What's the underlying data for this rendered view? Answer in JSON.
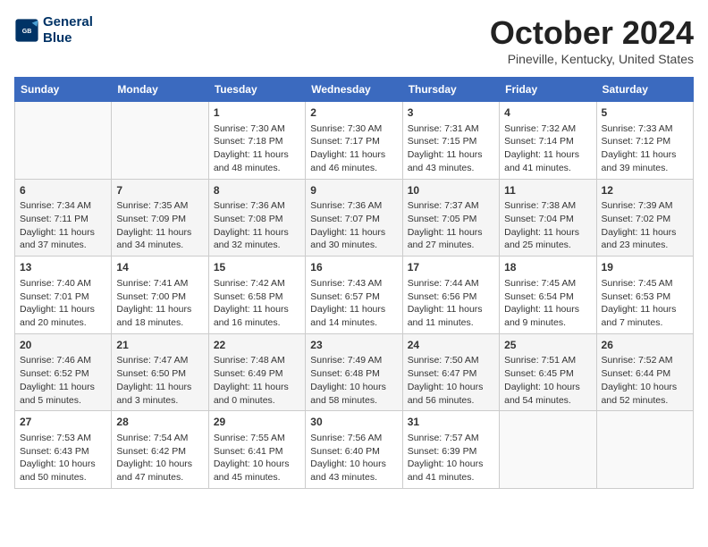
{
  "header": {
    "logo_line1": "General",
    "logo_line2": "Blue",
    "month": "October 2024",
    "location": "Pineville, Kentucky, United States"
  },
  "days_of_week": [
    "Sunday",
    "Monday",
    "Tuesday",
    "Wednesday",
    "Thursday",
    "Friday",
    "Saturday"
  ],
  "weeks": [
    [
      {
        "day": "",
        "sunrise": "",
        "sunset": "",
        "daylight": ""
      },
      {
        "day": "",
        "sunrise": "",
        "sunset": "",
        "daylight": ""
      },
      {
        "day": "1",
        "sunrise": "Sunrise: 7:30 AM",
        "sunset": "Sunset: 7:18 PM",
        "daylight": "Daylight: 11 hours and 48 minutes."
      },
      {
        "day": "2",
        "sunrise": "Sunrise: 7:30 AM",
        "sunset": "Sunset: 7:17 PM",
        "daylight": "Daylight: 11 hours and 46 minutes."
      },
      {
        "day": "3",
        "sunrise": "Sunrise: 7:31 AM",
        "sunset": "Sunset: 7:15 PM",
        "daylight": "Daylight: 11 hours and 43 minutes."
      },
      {
        "day": "4",
        "sunrise": "Sunrise: 7:32 AM",
        "sunset": "Sunset: 7:14 PM",
        "daylight": "Daylight: 11 hours and 41 minutes."
      },
      {
        "day": "5",
        "sunrise": "Sunrise: 7:33 AM",
        "sunset": "Sunset: 7:12 PM",
        "daylight": "Daylight: 11 hours and 39 minutes."
      }
    ],
    [
      {
        "day": "6",
        "sunrise": "Sunrise: 7:34 AM",
        "sunset": "Sunset: 7:11 PM",
        "daylight": "Daylight: 11 hours and 37 minutes."
      },
      {
        "day": "7",
        "sunrise": "Sunrise: 7:35 AM",
        "sunset": "Sunset: 7:09 PM",
        "daylight": "Daylight: 11 hours and 34 minutes."
      },
      {
        "day": "8",
        "sunrise": "Sunrise: 7:36 AM",
        "sunset": "Sunset: 7:08 PM",
        "daylight": "Daylight: 11 hours and 32 minutes."
      },
      {
        "day": "9",
        "sunrise": "Sunrise: 7:36 AM",
        "sunset": "Sunset: 7:07 PM",
        "daylight": "Daylight: 11 hours and 30 minutes."
      },
      {
        "day": "10",
        "sunrise": "Sunrise: 7:37 AM",
        "sunset": "Sunset: 7:05 PM",
        "daylight": "Daylight: 11 hours and 27 minutes."
      },
      {
        "day": "11",
        "sunrise": "Sunrise: 7:38 AM",
        "sunset": "Sunset: 7:04 PM",
        "daylight": "Daylight: 11 hours and 25 minutes."
      },
      {
        "day": "12",
        "sunrise": "Sunrise: 7:39 AM",
        "sunset": "Sunset: 7:02 PM",
        "daylight": "Daylight: 11 hours and 23 minutes."
      }
    ],
    [
      {
        "day": "13",
        "sunrise": "Sunrise: 7:40 AM",
        "sunset": "Sunset: 7:01 PM",
        "daylight": "Daylight: 11 hours and 20 minutes."
      },
      {
        "day": "14",
        "sunrise": "Sunrise: 7:41 AM",
        "sunset": "Sunset: 7:00 PM",
        "daylight": "Daylight: 11 hours and 18 minutes."
      },
      {
        "day": "15",
        "sunrise": "Sunrise: 7:42 AM",
        "sunset": "Sunset: 6:58 PM",
        "daylight": "Daylight: 11 hours and 16 minutes."
      },
      {
        "day": "16",
        "sunrise": "Sunrise: 7:43 AM",
        "sunset": "Sunset: 6:57 PM",
        "daylight": "Daylight: 11 hours and 14 minutes."
      },
      {
        "day": "17",
        "sunrise": "Sunrise: 7:44 AM",
        "sunset": "Sunset: 6:56 PM",
        "daylight": "Daylight: 11 hours and 11 minutes."
      },
      {
        "day": "18",
        "sunrise": "Sunrise: 7:45 AM",
        "sunset": "Sunset: 6:54 PM",
        "daylight": "Daylight: 11 hours and 9 minutes."
      },
      {
        "day": "19",
        "sunrise": "Sunrise: 7:45 AM",
        "sunset": "Sunset: 6:53 PM",
        "daylight": "Daylight: 11 hours and 7 minutes."
      }
    ],
    [
      {
        "day": "20",
        "sunrise": "Sunrise: 7:46 AM",
        "sunset": "Sunset: 6:52 PM",
        "daylight": "Daylight: 11 hours and 5 minutes."
      },
      {
        "day": "21",
        "sunrise": "Sunrise: 7:47 AM",
        "sunset": "Sunset: 6:50 PM",
        "daylight": "Daylight: 11 hours and 3 minutes."
      },
      {
        "day": "22",
        "sunrise": "Sunrise: 7:48 AM",
        "sunset": "Sunset: 6:49 PM",
        "daylight": "Daylight: 11 hours and 0 minutes."
      },
      {
        "day": "23",
        "sunrise": "Sunrise: 7:49 AM",
        "sunset": "Sunset: 6:48 PM",
        "daylight": "Daylight: 10 hours and 58 minutes."
      },
      {
        "day": "24",
        "sunrise": "Sunrise: 7:50 AM",
        "sunset": "Sunset: 6:47 PM",
        "daylight": "Daylight: 10 hours and 56 minutes."
      },
      {
        "day": "25",
        "sunrise": "Sunrise: 7:51 AM",
        "sunset": "Sunset: 6:45 PM",
        "daylight": "Daylight: 10 hours and 54 minutes."
      },
      {
        "day": "26",
        "sunrise": "Sunrise: 7:52 AM",
        "sunset": "Sunset: 6:44 PM",
        "daylight": "Daylight: 10 hours and 52 minutes."
      }
    ],
    [
      {
        "day": "27",
        "sunrise": "Sunrise: 7:53 AM",
        "sunset": "Sunset: 6:43 PM",
        "daylight": "Daylight: 10 hours and 50 minutes."
      },
      {
        "day": "28",
        "sunrise": "Sunrise: 7:54 AM",
        "sunset": "Sunset: 6:42 PM",
        "daylight": "Daylight: 10 hours and 47 minutes."
      },
      {
        "day": "29",
        "sunrise": "Sunrise: 7:55 AM",
        "sunset": "Sunset: 6:41 PM",
        "daylight": "Daylight: 10 hours and 45 minutes."
      },
      {
        "day": "30",
        "sunrise": "Sunrise: 7:56 AM",
        "sunset": "Sunset: 6:40 PM",
        "daylight": "Daylight: 10 hours and 43 minutes."
      },
      {
        "day": "31",
        "sunrise": "Sunrise: 7:57 AM",
        "sunset": "Sunset: 6:39 PM",
        "daylight": "Daylight: 10 hours and 41 minutes."
      },
      {
        "day": "",
        "sunrise": "",
        "sunset": "",
        "daylight": ""
      },
      {
        "day": "",
        "sunrise": "",
        "sunset": "",
        "daylight": ""
      }
    ]
  ]
}
